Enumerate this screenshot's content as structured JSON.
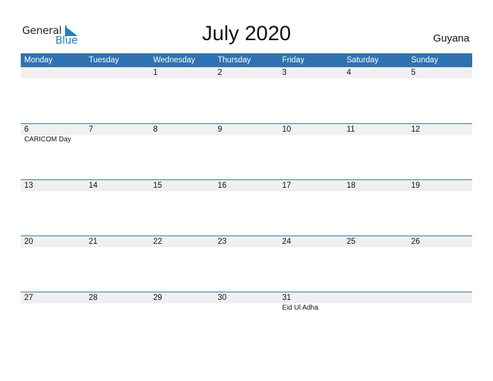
{
  "logo": {
    "word1": "General",
    "word2": "Blue",
    "icon": "flag-triangle-icon"
  },
  "title": "July 2020",
  "country": "Guyana",
  "colors": {
    "header": "#2e72b2",
    "logo_blue": "#1f7ec6",
    "date_band": "#f0f0f0"
  },
  "weekdays": [
    "Monday",
    "Tuesday",
    "Wednesday",
    "Thursday",
    "Friday",
    "Saturday",
    "Sunday"
  ],
  "weeks": [
    {
      "days": [
        "",
        "",
        "1",
        "2",
        "3",
        "4",
        "5"
      ],
      "events": [
        "",
        "",
        "",
        "",
        "",
        "",
        ""
      ]
    },
    {
      "days": [
        "6",
        "7",
        "8",
        "9",
        "10",
        "11",
        "12"
      ],
      "events": [
        "CARICOM Day",
        "",
        "",
        "",
        "",
        "",
        ""
      ]
    },
    {
      "days": [
        "13",
        "14",
        "15",
        "16",
        "17",
        "18",
        "19"
      ],
      "events": [
        "",
        "",
        "",
        "",
        "",
        "",
        ""
      ]
    },
    {
      "days": [
        "20",
        "21",
        "22",
        "23",
        "24",
        "25",
        "26"
      ],
      "events": [
        "",
        "",
        "",
        "",
        "",
        "",
        ""
      ]
    },
    {
      "days": [
        "27",
        "28",
        "29",
        "30",
        "31",
        "",
        ""
      ],
      "events": [
        "",
        "",
        "",
        "",
        "Eid Ul Adha",
        "",
        ""
      ]
    }
  ]
}
